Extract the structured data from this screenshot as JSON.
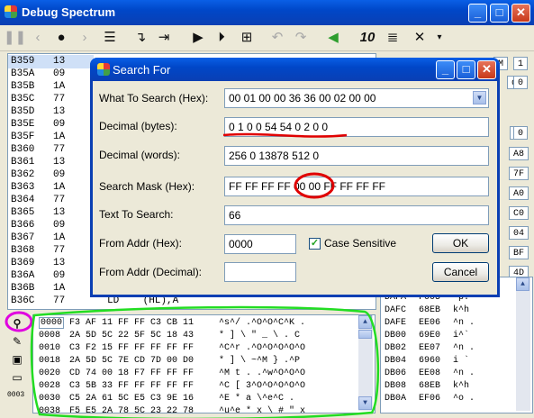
{
  "window": {
    "title": "Debug Spectrum"
  },
  "toolbar": {
    "ten_label": "10"
  },
  "code_rows": [
    {
      "addr": "B359",
      "hex": "13"
    },
    {
      "addr": "B35A",
      "hex": "09"
    },
    {
      "addr": "B35B",
      "hex": "1A"
    },
    {
      "addr": "B35C",
      "hex": "77"
    },
    {
      "addr": "B35D",
      "hex": "13"
    },
    {
      "addr": "B35E",
      "hex": "09"
    },
    {
      "addr": "B35F",
      "hex": "1A"
    },
    {
      "addr": "B360",
      "hex": "77"
    },
    {
      "addr": "B361",
      "hex": "13"
    },
    {
      "addr": "B362",
      "hex": "09"
    },
    {
      "addr": "B363",
      "hex": "1A"
    },
    {
      "addr": "B364",
      "hex": "77"
    },
    {
      "addr": "B365",
      "hex": "13"
    },
    {
      "addr": "B366",
      "hex": "09"
    },
    {
      "addr": "B367",
      "hex": "1A"
    },
    {
      "addr": "B368",
      "hex": "77"
    },
    {
      "addr": "B369",
      "hex": "13"
    },
    {
      "addr": "B36A",
      "hex": "09"
    },
    {
      "addr": "B36B",
      "hex": "1A"
    },
    {
      "addr": "B36C",
      "hex": "77",
      "instr": "LD    (HL),A"
    }
  ],
  "right_boxes": [
    "M",
    "1",
    "d",
    "0",
    "C",
    "0"
  ],
  "right_partial": [
    "A8",
    "7F",
    "A0",
    "C0",
    "04",
    "BF",
    "4D"
  ],
  "mem_rows": [
    {
      "addr": "DAFA",
      "val": "F005",
      "txt": "^p."
    },
    {
      "addr": "DAFC",
      "val": "68EB",
      "txt": "k^h"
    },
    {
      "addr": "DAFE",
      "val": "EE06",
      "txt": "^n ."
    },
    {
      "addr": "DB00",
      "val": "69E0",
      "txt": "i^`"
    },
    {
      "addr": "DB02",
      "val": "EE07",
      "txt": "^n ."
    },
    {
      "addr": "DB04",
      "val": "6960",
      "txt": "i `"
    },
    {
      "addr": "DB06",
      "val": "EE08",
      "txt": "^n ."
    },
    {
      "addr": "DB08",
      "val": "68EB",
      "txt": "k^h"
    },
    {
      "addr": "DB0A",
      "val": "EF06",
      "txt": "^o ."
    }
  ],
  "hex_rows": [
    {
      "addr": "0000",
      "bytes": "F3 AF 11 FF FF C3 CB 11",
      "txt": "^s^/ .^O^O^C^K ."
    },
    {
      "addr": "0008",
      "bytes": "2A 5D 5C 22 5F 5C 18 43",
      "txt": "* ] \\ \" _ \\ . C"
    },
    {
      "addr": "0010",
      "bytes": "C3 F2 15 FF FF FF FF FF",
      "txt": "^C^r .^O^O^O^O^O"
    },
    {
      "addr": "0018",
      "bytes": "2A 5D 5C 7E CD 7D 00 D0",
      "txt": "* ] \\ ~^M } .^P"
    },
    {
      "addr": "0020",
      "bytes": "CD 74 00 18 F7 FF FF FF",
      "txt": "^M t . .^w^O^O^O"
    },
    {
      "addr": "0028",
      "bytes": "C3 5B 33 FF FF FF FF FF",
      "txt": "^C [ 3^O^O^O^O^O"
    },
    {
      "addr": "0030",
      "bytes": "C5 2A 61 5C E5 C3 9E 16",
      "txt": "^E * a \\^e^C ."
    },
    {
      "addr": "0038",
      "bytes": "F5 E5 2A 78 5C 23 22 78",
      "txt": "^u^e * x \\ # \" x"
    }
  ],
  "dialog": {
    "title": "Search For",
    "what_label": "What To Search (Hex):",
    "what_value": "00 01 00 00 36 36 00 02 00 00",
    "dec_bytes_label": "Decimal (bytes):",
    "dec_bytes_value": "0 1 0 0 54 54 0 2 0 0",
    "dec_words_label": "Decimal (words):",
    "dec_words_value": "256 0 13878 512 0",
    "mask_label": "Search Mask (Hex):",
    "mask_value": "FF FF FF FF 00 00 FF FF FF FF",
    "text_label": "Text To Search:",
    "text_value": "66",
    "from_hex_label": "From Addr (Hex):",
    "from_hex_value": "0000",
    "case_label": "Case Sensitive",
    "case_checked": true,
    "ok_label": "OK",
    "cancel_label": "Cancel",
    "from_dec_label": "From Addr (Decimal):",
    "from_dec_value": ""
  },
  "left_tools": [
    "binoculars-icon",
    "edit-icon",
    "save-icon",
    "open-icon",
    "memory-icon"
  ],
  "left_tool_text": "0003",
  "annotation_colors": {
    "red": "#e00000",
    "green": "#22dd22",
    "magenta": "#e000e0"
  }
}
